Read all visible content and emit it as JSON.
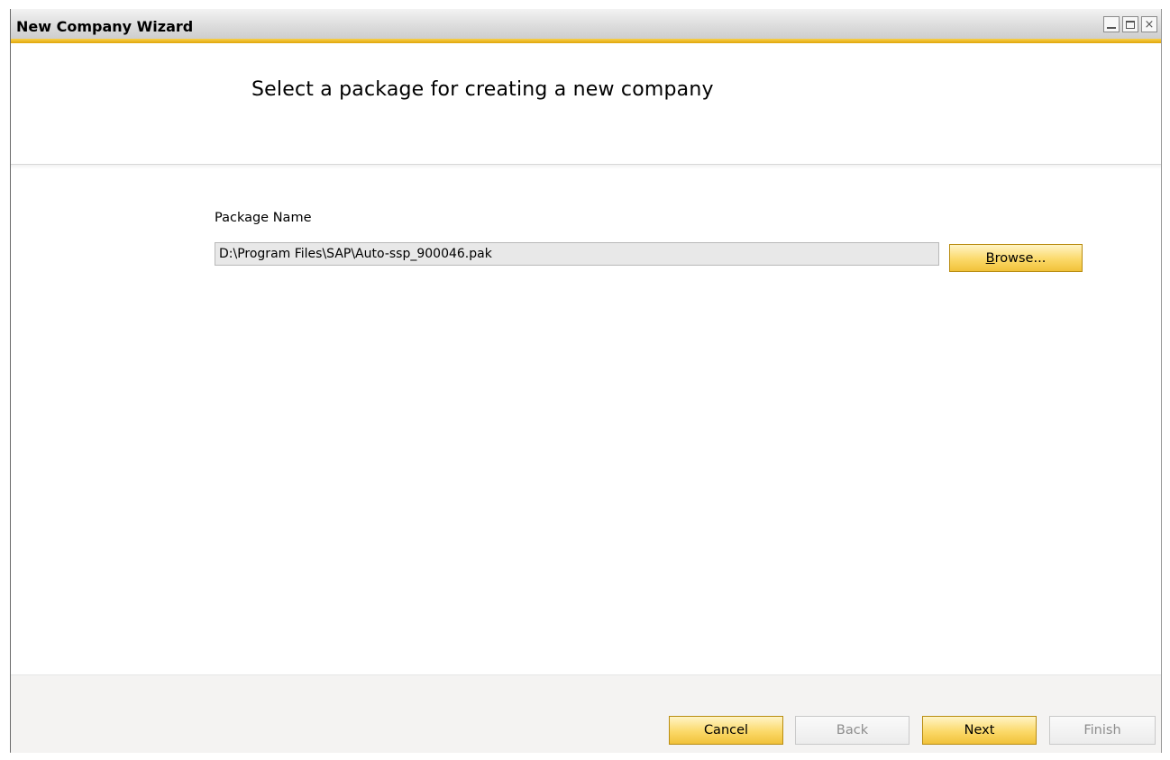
{
  "window": {
    "title": "New Company Wizard",
    "controls": {
      "close_glyph": "×"
    }
  },
  "header": {
    "title": "Select a package for creating a new company"
  },
  "form": {
    "package_label": "Package Name",
    "package_value": "D:\\Program Files\\SAP\\Auto-ssp_900046.pak",
    "browse_mnemonic": "B",
    "browse_rest": "rowse..."
  },
  "footer": {
    "cancel": "Cancel",
    "back": "Back",
    "next": "Next",
    "finish": "Finish"
  },
  "colors": {
    "accent_gold": "#f1c23a",
    "title_bar": "#dedede",
    "footer_bg": "#f4f3f2",
    "disabled_text": "#8c8c8c"
  },
  "icons": [
    "minimize-icon",
    "maximize-icon",
    "close-icon"
  ]
}
